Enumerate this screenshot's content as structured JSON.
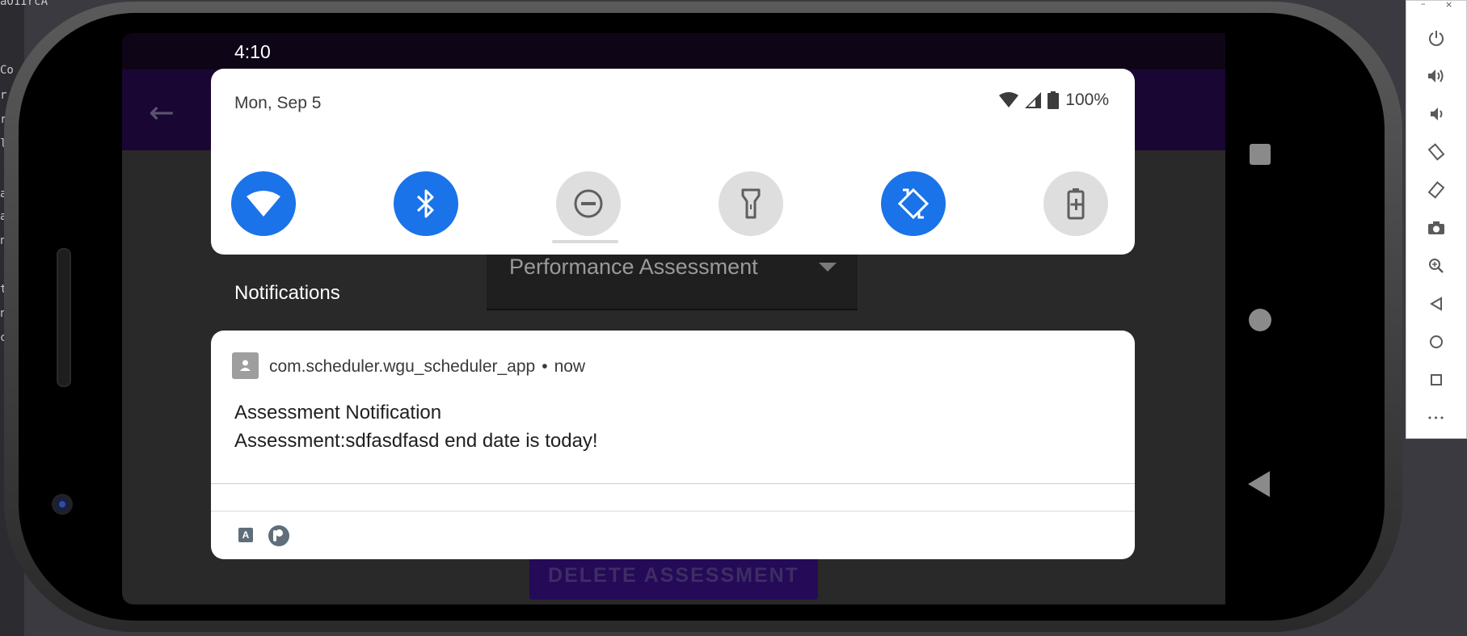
{
  "ide": {
    "fragments": [
      "aO1IrcA",
      "Co",
      "r",
      "ri",
      "lo",
      "a",
      "a",
      "n",
      "t",
      "nl",
      "c"
    ]
  },
  "status_bar": {
    "time": "4:10"
  },
  "app": {
    "dropdown_value": "Performance Assessment",
    "delete_button_label": "DELETE ASSESSMENT"
  },
  "quick_settings": {
    "date": "Mon, Sep 5",
    "battery": "100%",
    "tiles": [
      {
        "name": "wifi",
        "icon": "wifi-icon",
        "state": "on"
      },
      {
        "name": "bluetooth",
        "icon": "bluetooth-icon",
        "state": "on"
      },
      {
        "name": "do-not-disturb",
        "icon": "do-not-disturb-icon",
        "state": "off"
      },
      {
        "name": "flashlight",
        "icon": "flashlight-icon",
        "state": "off"
      },
      {
        "name": "auto-rotate",
        "icon": "auto-rotate-icon",
        "state": "on"
      },
      {
        "name": "battery-saver",
        "icon": "battery-saver-icon",
        "state": "off"
      }
    ]
  },
  "notifications": {
    "header": "Notifications",
    "items": [
      {
        "app_name": "com.scheduler.wgu_scheduler_app",
        "separator": "•",
        "time": "now",
        "title": "Assessment Notification",
        "text": "Assessment:sdfasdfasd end date is today!"
      }
    ]
  },
  "emulator_toolbar": {
    "minimize": "–",
    "close": "×",
    "buttons": [
      "power-icon",
      "volume-up-icon",
      "volume-down-icon",
      "rotate-left-icon",
      "rotate-right-icon",
      "camera-icon",
      "zoom-icon",
      "back-icon",
      "home-icon",
      "overview-icon",
      "more-icon"
    ],
    "more_label": "•••"
  },
  "colors": {
    "accent": "#1a73e8",
    "app_bar": "#1a0633",
    "tile_off": "#dedede"
  }
}
